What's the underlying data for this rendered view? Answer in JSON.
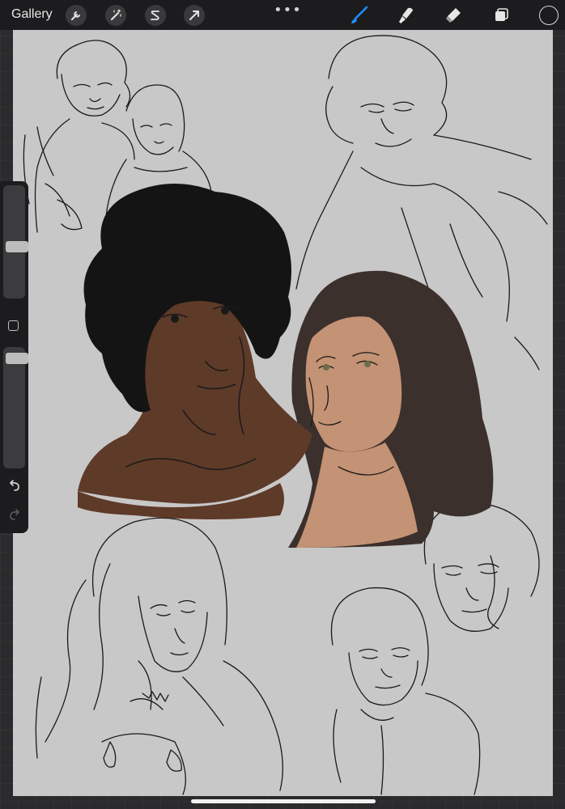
{
  "topbar": {
    "gallery_label": "Gallery",
    "actions_icon": "wrench-icon",
    "adjustments_icon": "magic-wand-icon",
    "selection_icon": "selection-s-icon",
    "transform_icon": "arrow-cursor-icon",
    "more_label": "•••",
    "brush_icon": "brush-icon",
    "smudge_icon": "smudge-icon",
    "eraser_icon": "eraser-icon",
    "layers_icon": "layers-icon",
    "current_color": "#1c1c1e",
    "accent": "#1e90ff"
  },
  "sidebar": {
    "brush_size_level": 0.45,
    "opacity_level": 0.05,
    "modify_icon": "square-icon",
    "undo_icon": "undo-icon",
    "redo_icon": "redo-icon"
  },
  "canvas": {
    "background": "#c8c8c8",
    "man_skin": "#5e3a28",
    "woman_skin": "#c49274",
    "woman_hair": "#3b302c",
    "man_hair": "#141414"
  }
}
